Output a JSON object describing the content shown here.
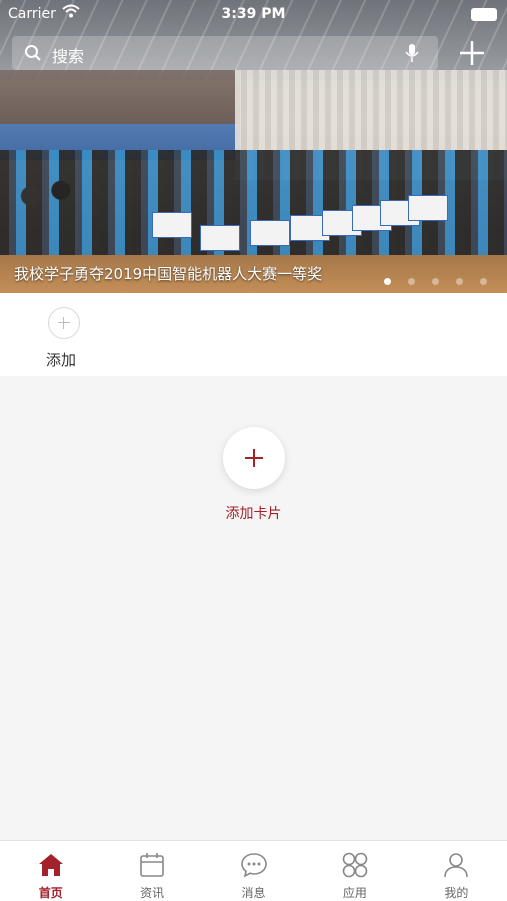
{
  "status_bar": {
    "carrier": "Carrier",
    "time": "3:39 PM"
  },
  "search": {
    "placeholder": "搜索"
  },
  "banner": {
    "caption": "我校学子勇夺2019中国智能机器人大赛一等奖",
    "dots_total": 5,
    "dots_active_index": 0
  },
  "quick_add": {
    "label": "添加"
  },
  "add_card": {
    "label": "添加卡片"
  },
  "colors": {
    "accent": "#a4202b",
    "background": "#f5f5f5"
  },
  "tabs": [
    {
      "label": "首页",
      "icon": "home-icon",
      "active": true
    },
    {
      "label": "资讯",
      "icon": "calendar-icon",
      "active": false
    },
    {
      "label": "消息",
      "icon": "chat-icon",
      "active": false
    },
    {
      "label": "应用",
      "icon": "apps-grid-icon",
      "active": false
    },
    {
      "label": "我的",
      "icon": "user-icon",
      "active": false
    }
  ]
}
